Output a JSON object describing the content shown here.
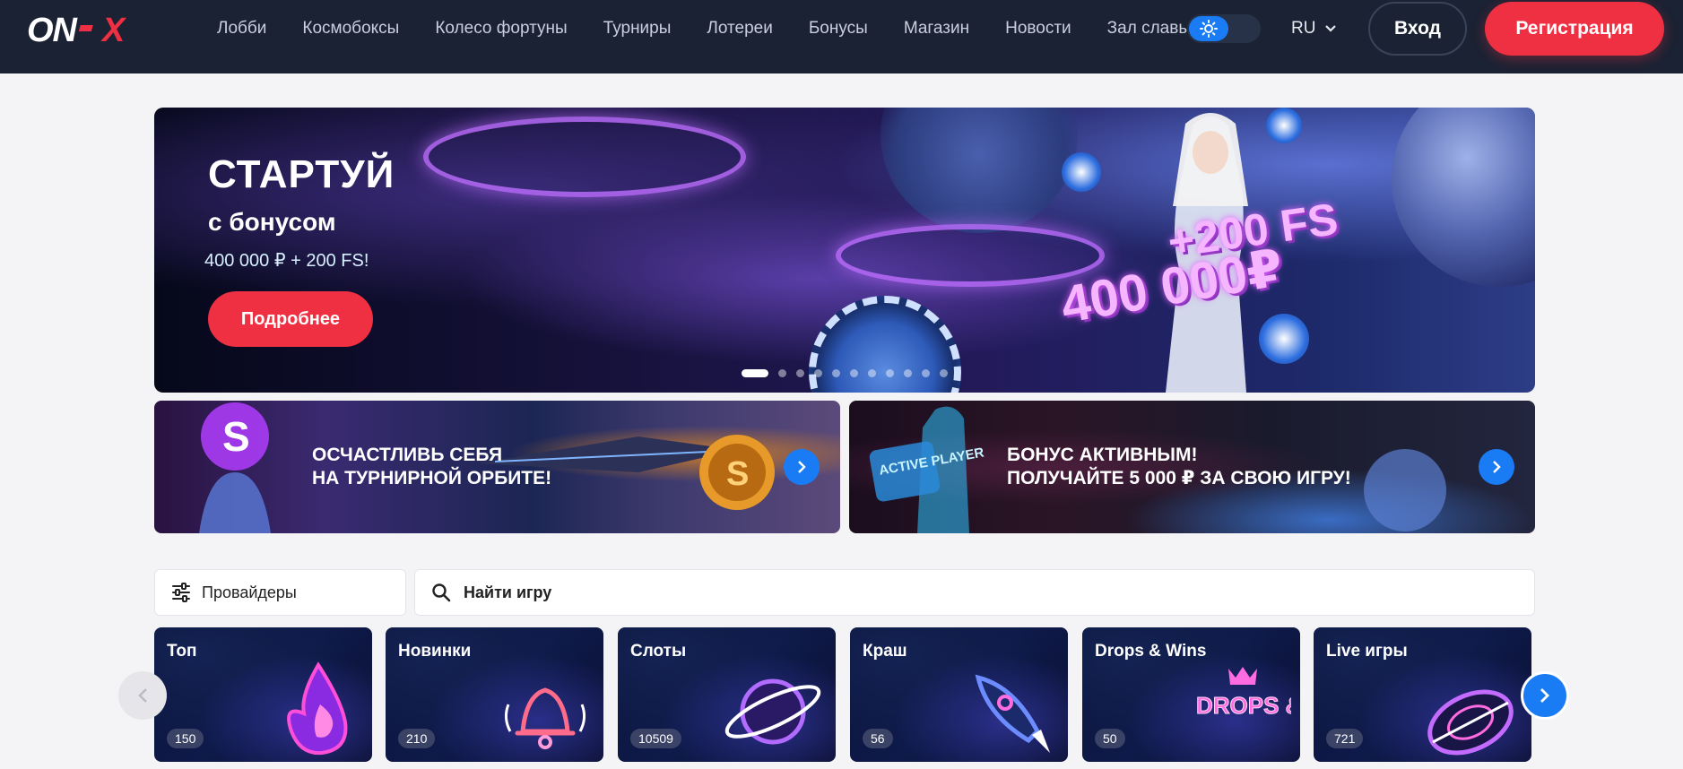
{
  "header": {
    "nav": [
      "Лобби",
      "Космобоксы",
      "Колесо фортуны",
      "Турниры",
      "Лотереи",
      "Бонусы",
      "Магазин",
      "Новости",
      "Зал славы"
    ],
    "language": "RU",
    "login_label": "Вход",
    "register_label": "Регистрация"
  },
  "hero": {
    "title": "СТАРТУЙ",
    "subtitle": "с бонусом",
    "amount": "400 000 ₽ + 200 FS!",
    "button_label": "Подробнее",
    "promo_fs": "+200 FS",
    "promo_amount": "400 000₽",
    "slides_total": 11,
    "active_slide": 1
  },
  "promos": [
    {
      "line1": "ОСЧАСТЛИВЬ СЕБЯ",
      "line2": "НА ТУРНИРНОЙ ОРБИТЕ!"
    },
    {
      "line1": "БОНУС АКТИВНЫМ!",
      "line2": "ПОЛУЧАЙТЕ 5 000 ₽ ЗА СВОЮ ИГРУ!",
      "badge": "ACTIVE PLAYER"
    }
  ],
  "filters": {
    "providers_label": "Провайдеры",
    "search_placeholder": "Найти игру"
  },
  "categories": [
    {
      "label": "Топ",
      "count": "150",
      "icon": "flame-icon"
    },
    {
      "label": "Новинки",
      "count": "210",
      "icon": "bell-icon"
    },
    {
      "label": "Слоты",
      "count": "10509",
      "icon": "planet-icon"
    },
    {
      "label": "Краш",
      "count": "56",
      "icon": "rocket-icon"
    },
    {
      "label": "Drops & Wins",
      "count": "50",
      "icon": "drops-wins-logo",
      "logo_text": "DROPS & WINS"
    },
    {
      "label": "Live игры",
      "count": "721",
      "icon": "roulette-icon"
    }
  ],
  "colors": {
    "header_bg": "#1b2233",
    "accent_red": "#ef2f42",
    "accent_blue": "#1a7cf5",
    "page_bg": "#f4f4f6"
  }
}
